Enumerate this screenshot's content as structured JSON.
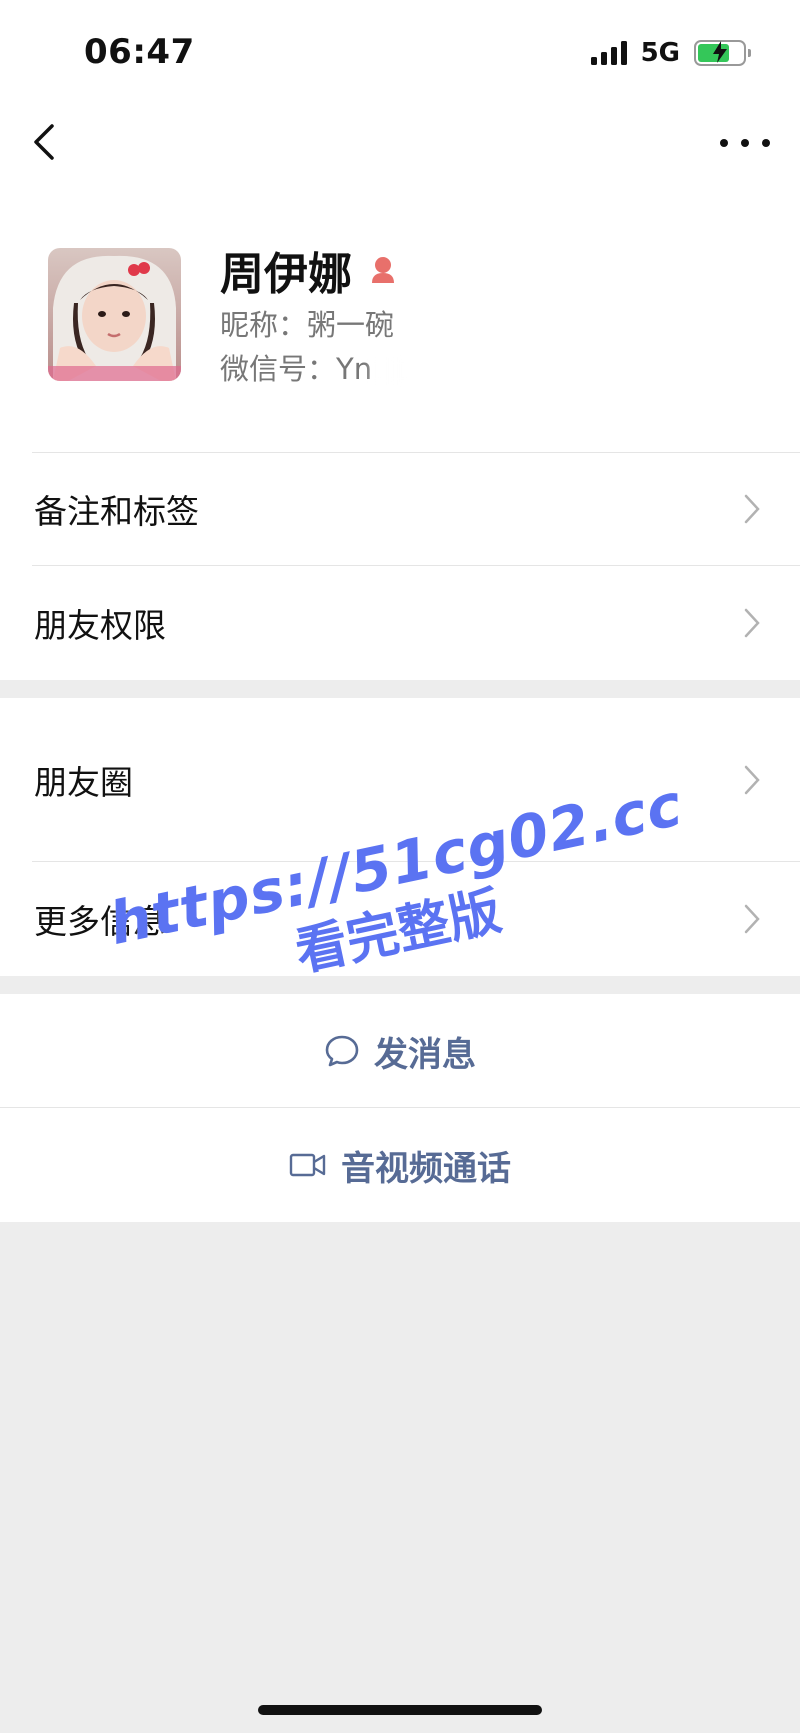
{
  "status_bar": {
    "time": "06:47",
    "network": "5G",
    "signal_icon": "signal-bars-icon",
    "battery_icon": "battery-charging-icon"
  },
  "nav": {
    "back_icon": "chevron-left-icon",
    "more_icon": "more-dots-icon"
  },
  "profile": {
    "name": "周伊娜",
    "gender_icon": "female-icon",
    "nickname": "昵称：粥一碗",
    "wechat_id": "微信号：Yn"
  },
  "menu_section_1": [
    {
      "label": "备注和标签"
    },
    {
      "label": "朋友权限"
    }
  ],
  "menu_section_2": [
    {
      "label": "朋友圈"
    },
    {
      "label": "更多信息"
    }
  ],
  "actions": {
    "message_label": "发消息",
    "call_label": "音视频通话"
  },
  "watermark": {
    "url": "https://51cg02.cc",
    "subtitle": "看完整版"
  },
  "colors": {
    "link": "#576b95",
    "watermark": "#5b73f2",
    "gender": "#e8706b",
    "background": "#ededed"
  }
}
